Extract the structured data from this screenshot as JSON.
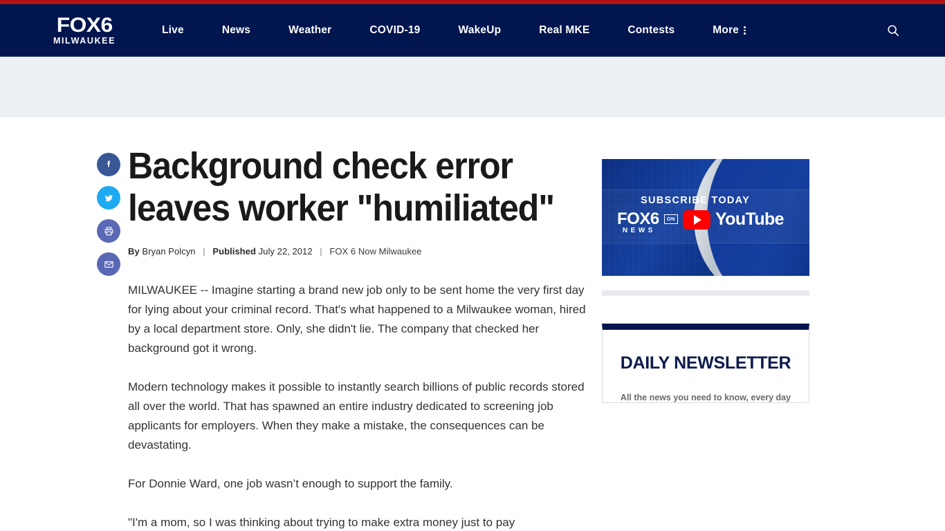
{
  "header": {
    "logo_main": "FOX6",
    "logo_sub": "MILWAUKEE",
    "nav_items": [
      {
        "label": "Live"
      },
      {
        "label": "News"
      },
      {
        "label": "Weather"
      },
      {
        "label": "COVID-19"
      },
      {
        "label": "WakeUp"
      },
      {
        "label": "Real MKE"
      },
      {
        "label": "Contests"
      },
      {
        "label": "More"
      }
    ],
    "search_icon": "search-icon",
    "more_icon": "kebab-menu-icon",
    "accent_red": "#b41313",
    "navy": "#01154e"
  },
  "share": {
    "buttons": [
      {
        "name": "facebook",
        "glyph": "f",
        "color": "#3a5795"
      },
      {
        "name": "twitter",
        "glyph": "twitter-bird",
        "color": "#1eaaf1"
      },
      {
        "name": "print",
        "glyph": "printer",
        "color": "#5a68b5"
      },
      {
        "name": "email",
        "glyph": "envelope",
        "color": "#5a68b5"
      }
    ]
  },
  "article": {
    "headline": "Background check error leaves worker \"humiliated\"",
    "byline": {
      "by_label": "By",
      "author": "Bryan Polcyn",
      "published_label": "Published",
      "date": "July 22, 2012",
      "source": "FOX 6 Now Milwaukee",
      "separator": "|"
    },
    "paragraphs": [
      "MILWAUKEE -- Imagine starting a brand new job only to be sent home the very first day for lying about your criminal record.  That's what happened to a Milwaukee woman, hired by a local department store.  Only, she didn't lie.  The company that checked her background got it wrong.",
      "Modern technology makes it possible to instantly search billions of public records stored all over the world. That has spawned an entire industry dedicated to screening job applicants for employers. When they make a mistake, the consequences can be devastating.",
      "For Donnie Ward, one job wasn’t enough to support the family.",
      "\"I'm a mom, so I was thinking about trying to make extra money just to pay"
    ]
  },
  "sidebar": {
    "promo": {
      "subscribe_text": "SUBSCRIBE TODAY",
      "brand_main": "FOX6",
      "brand_sub": "NEWS",
      "on_label": "ON",
      "platform": "YouTube",
      "play_icon": "youtube-play-icon"
    },
    "newsletter": {
      "title": "DAILY NEWSLETTER",
      "subtitle": "All the news you need to know, every day"
    }
  }
}
